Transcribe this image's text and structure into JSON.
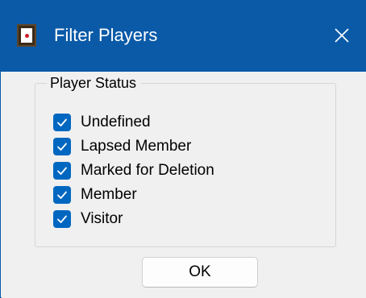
{
  "window": {
    "title": "Filter Players",
    "icon": "app-card-icon",
    "close_icon": "close-icon"
  },
  "group": {
    "legend": "Player Status",
    "items": [
      {
        "label": "Undefined",
        "checked": true
      },
      {
        "label": "Lapsed Member",
        "checked": true
      },
      {
        "label": "Marked for Deletion",
        "checked": true
      },
      {
        "label": "Member",
        "checked": true
      },
      {
        "label": "Visitor",
        "checked": true
      }
    ]
  },
  "buttons": {
    "ok_label": "OK"
  },
  "colors": {
    "titlebar": "#0a5aa8",
    "checkbox_checked": "#0067c0",
    "dialog_bg": "#f0f0f0"
  }
}
